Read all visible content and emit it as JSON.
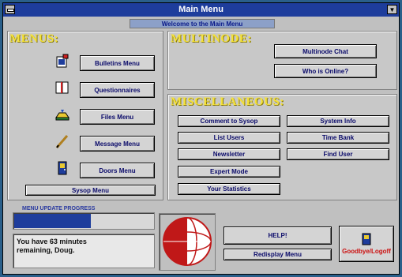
{
  "window": {
    "title": "Main Menu",
    "welcome": "Welcome to the Main Menu"
  },
  "sections": {
    "menus": "MENUS:",
    "multinode": "MULTINODE:",
    "miscellaneous": "MISCELLANEOUS:"
  },
  "menus": {
    "bulletins": "Bulletins Menu",
    "questionnaires": "Questionnaires",
    "files": "Files Menu",
    "message": "Message Menu",
    "doors": "Doors Menu",
    "sysop": "Sysop Menu"
  },
  "multinode": {
    "chat": "Multinode Chat",
    "who": "Who is Online?"
  },
  "misc": {
    "comment": "Comment to Sysop",
    "list_users": "List Users",
    "newsletter": "Newsletter",
    "expert": "Expert Mode",
    "stats": "Your Statistics",
    "sysinfo": "System Info",
    "timebank": "Time Bank",
    "finduser": "Find User"
  },
  "progress": {
    "label": "MENU UPDATE PROGRESS",
    "fraction": 0.55
  },
  "status": {
    "line1": "You have 63 minutes",
    "line2": "remaining, Doug."
  },
  "actions": {
    "help": "HELP!",
    "redisplay": "Redisplay Menu",
    "goodbye": "Goodbye/Logoff"
  },
  "colors": {
    "title": "#1e3d9c",
    "accent": "#f5e23a",
    "button_text": "#0a0a6a",
    "goodbye": "#cc1010"
  }
}
